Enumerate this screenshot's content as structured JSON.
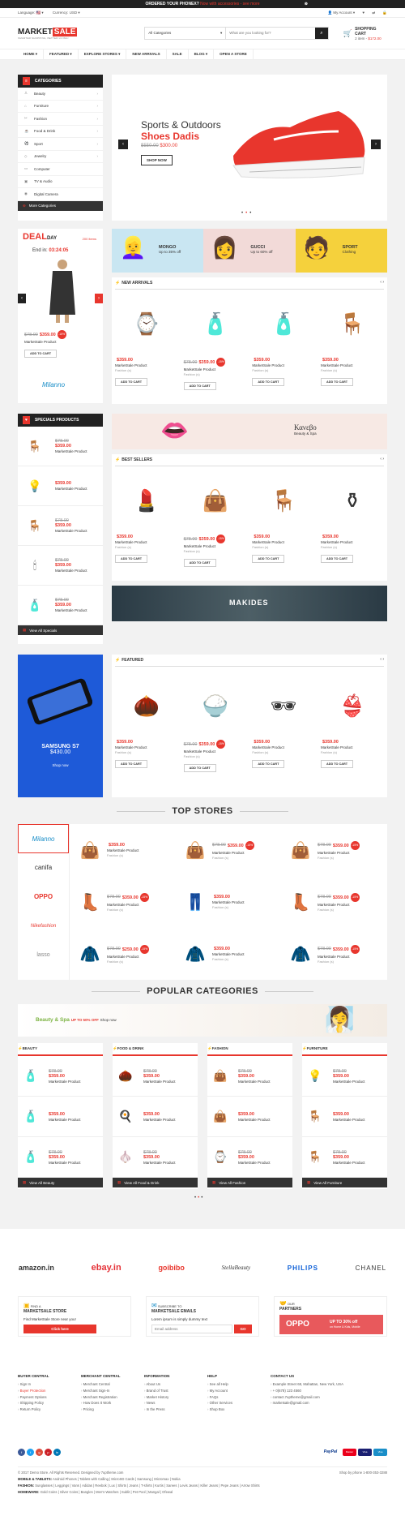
{
  "topbar": {
    "text": "ORDERED YOUR PHONEX?",
    "highlight": " Now with accessories - see more",
    "close": "⊗"
  },
  "util": {
    "language": "Language: 🇺🇸 ▾",
    "currency": "Currency: USD ▾",
    "account": "👤 My Account ▾",
    "icons": [
      "♥",
      "⇄",
      "🔒"
    ]
  },
  "header": {
    "logo_main": "MARKET",
    "logo_accent": "SALE",
    "logo_tag": "SMARTER SHOPPING, BETTER LIVING!",
    "category": "All Categories",
    "search_placeholder": "What are you looking for?",
    "cart_title": "SHOPPING CART",
    "cart_items": "2 item - ",
    "cart_total": "$172.00"
  },
  "nav": [
    "HOME ▾",
    "FEATURED ▾",
    "EXPLORE STORES ▾",
    "NEW ARRIVALS",
    "SALE",
    "BLOG ▾",
    "OPEN A STORE"
  ],
  "sidebar": {
    "title": "CATEGORIES",
    "items": [
      {
        "icon": "♙",
        "label": "Beauty"
      },
      {
        "icon": "⌂",
        "label": "Furniture"
      },
      {
        "icon": "✂",
        "label": "Fashion"
      },
      {
        "icon": "☕",
        "label": "Food & Drink"
      },
      {
        "icon": "⚽",
        "label": "Sport"
      },
      {
        "icon": "◇",
        "label": "Jewelry"
      },
      {
        "icon": "▭",
        "label": "Computer"
      },
      {
        "icon": "▣",
        "label": "TV & Audio"
      },
      {
        "icon": "◉",
        "label": "Digital Camera"
      }
    ],
    "more": "More Categories"
  },
  "hero": {
    "title": "Sports & Outdoors",
    "subtitle": "Shoes Dadis",
    "old_price": "$550.00",
    "price": "$300.00",
    "button": "SHOP NOW"
  },
  "promos": [
    {
      "title": "MONGO",
      "sub": "Up to 35% off"
    },
    {
      "title": "GUCCI",
      "sub": "Up to 60% off"
    },
    {
      "title": "SPORT",
      "sub": "Clothing"
    }
  ],
  "deal": {
    "logo": "DEAL",
    "logo2": "DAY",
    "count": "200 items",
    "end_label": "End in:",
    "timer": "03:24:05",
    "old_price": "$78.00",
    "price": "$359.00",
    "badge": "-15%",
    "name": "MarketSale Product",
    "button": "ADD TO CART",
    "brand": "Milanno"
  },
  "new_arrivals": {
    "title": "NEW ARRIVALS",
    "products": [
      {
        "icon": "⌚",
        "old": "",
        "price": "$359.00",
        "badge": "",
        "name": "MarketSale Product",
        "cat": "Fashion (s)",
        "btn": "ADD TO CART"
      },
      {
        "icon": "🧴",
        "old": "$78.00",
        "price": "$359.00",
        "badge": "-15%",
        "name": "MarketSale Product",
        "cat": "Fashion (s)",
        "btn": "ADD TO CART"
      },
      {
        "icon": "🧴",
        "old": "",
        "price": "$359.00",
        "badge": "",
        "name": "MarketSale Product",
        "cat": "Fashion (s)",
        "btn": "ADD TO CART"
      },
      {
        "icon": "🪑",
        "old": "",
        "price": "$359.00",
        "badge": "",
        "name": "MarketSale Product",
        "cat": "Fashion (s)",
        "btn": "ADD TO CART"
      }
    ]
  },
  "specials": {
    "title": "SPECIALS PRODUCTS",
    "items": [
      {
        "icon": "🪑",
        "old": "$78.00",
        "price": "$359.00",
        "name": "MarketSale Product"
      },
      {
        "icon": "💡",
        "old": "",
        "price": "$359.00",
        "name": "MarketSale Product"
      },
      {
        "icon": "🪑",
        "old": "$78.00",
        "price": "$359.00",
        "name": "MarketSale Product"
      },
      {
        "icon": "🕯",
        "old": "$78.00",
        "price": "$359.00",
        "name": "MarketSale Product"
      },
      {
        "icon": "🧴",
        "old": "$78.00",
        "price": "$359.00",
        "name": "MarketSale Product"
      }
    ],
    "view_all": "View All Specials"
  },
  "kanebo": {
    "title": "Κανεβο",
    "sub": "Beauty & Spa"
  },
  "best_sellers": {
    "title": "BEST SELLERS",
    "products": [
      {
        "icon": "💄",
        "old": "",
        "price": "$359.00",
        "badge": "",
        "name": "MarketSale Product",
        "cat": "Fashion (s)",
        "btn": "ADD TO CART"
      },
      {
        "icon": "👜",
        "old": "$78.00",
        "price": "$359.00",
        "badge": "-15%",
        "name": "MarketSale Product",
        "cat": "Fashion (s)",
        "btn": "ADD TO CART"
      },
      {
        "icon": "🪑",
        "old": "",
        "price": "$359.00",
        "badge": "",
        "name": "MarketSale Product",
        "cat": "Fashion (s)",
        "btn": "ADD TO CART"
      },
      {
        "icon": "⚱",
        "old": "",
        "price": "$359.00",
        "badge": "",
        "name": "MarketSale Product",
        "cat": "Fashion (s)",
        "btn": "ADD TO CART"
      }
    ]
  },
  "makides": {
    "text": "MAKIDES"
  },
  "samsung": {
    "title": "SAMSUNG S7",
    "price": "$430.00",
    "link": "Shop now"
  },
  "featured": {
    "title": "FEATURED",
    "products": [
      {
        "icon": "🌰",
        "old": "",
        "price": "$359.00",
        "badge": "",
        "name": "MarketSale Product",
        "cat": "Fashion (s)",
        "btn": "ADD TO CART"
      },
      {
        "icon": "🍚",
        "old": "$78.00",
        "price": "$359.00",
        "badge": "-15%",
        "name": "MarketSale Product",
        "cat": "Fashion (s)",
        "btn": "ADD TO CART"
      },
      {
        "icon": "🕶",
        "old": "",
        "price": "$359.00",
        "badge": "",
        "name": "MarketSale Product",
        "cat": "Fashion (s)",
        "btn": "ADD TO CART"
      },
      {
        "icon": "👙",
        "old": "",
        "price": "$359.00",
        "badge": "",
        "name": "MarketSale Product",
        "cat": "Fashion (s)",
        "btn": "ADD TO CART"
      }
    ]
  },
  "top_stores": {
    "title": "TOP STORES",
    "stores": [
      "Milanno",
      "canifa",
      "OPPO",
      "Nikefashion",
      "lasso"
    ],
    "cells": [
      {
        "icon": "👜",
        "old": "",
        "price": "$359.00",
        "badge": "",
        "name": "MarketSale Product",
        "cat": "Fashion (s)"
      },
      {
        "icon": "👜",
        "old": "$78.00",
        "price": "$359.00",
        "badge": "-15%",
        "name": "MarketSale Product",
        "cat": "Fashion (s)"
      },
      {
        "icon": "👜",
        "old": "$78.00",
        "price": "$359.00",
        "badge": "-15%",
        "name": "MarketSale Product",
        "cat": "Fashion (s)"
      },
      {
        "icon": "👢",
        "old": "$78.00",
        "price": "$359.00",
        "badge": "-15%",
        "name": "MarketSale Product",
        "cat": "Fashion (s)"
      },
      {
        "icon": "👖",
        "old": "",
        "price": "$359.00",
        "badge": "",
        "name": "MarketSale Product",
        "cat": "Fashion (s)"
      },
      {
        "icon": "👢",
        "old": "$78.00",
        "price": "$359.00",
        "badge": "-15%",
        "name": "MarketSale Product",
        "cat": "Fashion (s)"
      },
      {
        "icon": "🧥",
        "old": "$78.00",
        "price": "$259.00",
        "badge": "-15%",
        "name": "MarketSale Product",
        "cat": "Fashion (s)"
      },
      {
        "icon": "🧥",
        "old": "",
        "price": "$359.00",
        "badge": "",
        "name": "MarketSale Product",
        "cat": "Fashion (s)"
      },
      {
        "icon": "🧥",
        "old": "$78.00",
        "price": "$359.00",
        "badge": "-15%",
        "name": "MarketSale Product",
        "cat": "Fashion (s)"
      }
    ]
  },
  "popular": {
    "title": "POPULAR CATEGORIES",
    "banner": {
      "title": "Beauty & Spa",
      "off": "UP TO 50% OFF",
      "link": "Shop now"
    },
    "cols": [
      {
        "title": "BEAUTY",
        "view": "View All Beauty",
        "items": [
          {
            "icon": "🧴",
            "old": "$78.00",
            "price": "$359.00",
            "name": "MarketSale Product"
          },
          {
            "icon": "🧴",
            "old": "",
            "price": "$359.00",
            "name": "MarketSale Product"
          },
          {
            "icon": "🧴",
            "old": "$78.00",
            "price": "$359.00",
            "name": "MarketSale Product"
          }
        ]
      },
      {
        "title": "FOOD & DRINK",
        "view": "View All Food & Drink",
        "items": [
          {
            "icon": "🌰",
            "old": "$78.00",
            "price": "$359.00",
            "name": "MarketSale Product"
          },
          {
            "icon": "🍳",
            "old": "",
            "price": "$359.00",
            "name": "MarketSale Product"
          },
          {
            "icon": "🧄",
            "old": "$78.00",
            "price": "$359.00",
            "name": "MarketSale Product"
          }
        ]
      },
      {
        "title": "FASHION",
        "view": "View All Fashion",
        "items": [
          {
            "icon": "👜",
            "old": "$78.00",
            "price": "$359.00",
            "name": "MarketSale Product"
          },
          {
            "icon": "👜",
            "old": "",
            "price": "$359.00",
            "name": "MarketSale Product"
          },
          {
            "icon": "⌚",
            "old": "$78.00",
            "price": "$359.00",
            "name": "MarketSale Product"
          }
        ]
      },
      {
        "title": "FURNITURE",
        "view": "View All Furniture",
        "items": [
          {
            "icon": "💡",
            "old": "$78.00",
            "price": "$359.00",
            "name": "MarketSale Product"
          },
          {
            "icon": "🪑",
            "old": "",
            "price": "$359.00",
            "name": "MarketSale Product"
          },
          {
            "icon": "🪑",
            "old": "$78.00",
            "price": "$359.00",
            "name": "MarketSale Product"
          }
        ]
      }
    ]
  },
  "brands": [
    "amazon.in",
    "ebay.in",
    "goibibo",
    "StellaBeauty",
    "PHILIPS",
    "CHANEL"
  ],
  "find": {
    "small": "FIND A",
    "title": "MARKETSALE STORE",
    "text": "Find MarketSale Store near you!",
    "button": "Click here"
  },
  "subscribe": {
    "small": "SUBSCRIBE TO",
    "title": "MARKETSALE EMAILS",
    "text": "Lorem ipsum is simply dummy text",
    "placeholder": "Email address",
    "button": "GO"
  },
  "partners": {
    "small": "OUR",
    "title": "PARTNERS",
    "brand": "OPPO",
    "offer": "UP TO 30% off",
    "sub": "on Home & Kids, Mobile"
  },
  "footer": {
    "cols": [
      {
        "title": "BUYER CENTRAL",
        "links": [
          "Sign In",
          "Buyer Protection",
          "Payment Options",
          "Shipping Policy",
          "Return Policy"
        ]
      },
      {
        "title": "MERCHANT CENTRAL",
        "links": [
          "Merchant Central",
          "Merchant Sign-In",
          "Merchant Registration",
          "How Does It Work",
          "Pricing"
        ]
      },
      {
        "title": "INFORMATION",
        "links": [
          "About Us",
          "Brand of Trust",
          "Market History",
          "News",
          "In the Press"
        ]
      },
      {
        "title": "HELP",
        "links": [
          "See all Help",
          "My Account",
          "FAQs",
          "Other Services",
          "Shop Box"
        ]
      }
    ],
    "contact": {
      "title": "CONTACT US",
      "lines": [
        "Example Street 68, Mahattan, New York, USA",
        "+ 0(678) 123 4560",
        "contact.7uptheme@gmail.com",
        "marketsale@gmail.com"
      ]
    },
    "copyright": "© 2017 Demo Store. All Rights Reserved. Designed by 7uptheme.com",
    "shop_by": "Shop by phone 1-800-353-3288",
    "cats": [
      {
        "label": "MOBILE & TABLETS:",
        "text": "Android Phones | Tablets with Calling | MicroSD Cards | Samsung | Micromax | Nokia"
      },
      {
        "label": "FASHION:",
        "text": "Sunglasses | Leggings | Vans | Adidas | Reebok | Lux | Shirts | Jeans | T-shirts | Kurtis | Sarees | Levis Jeans | Killer Jeans | Pepe Jeans | Arrow Shirts"
      },
      {
        "label": "HOMEWARE:",
        "text": "Gold Coins | Silver Coins | Bangles | Men's Watches | Sublit | Pet Pool | Mangal | Ofewal"
      }
    ],
    "social": [
      "f",
      "t",
      "g",
      "p",
      "in"
    ],
    "pay": [
      "PayPal",
      "Master",
      "Visa",
      "Visa"
    ]
  }
}
